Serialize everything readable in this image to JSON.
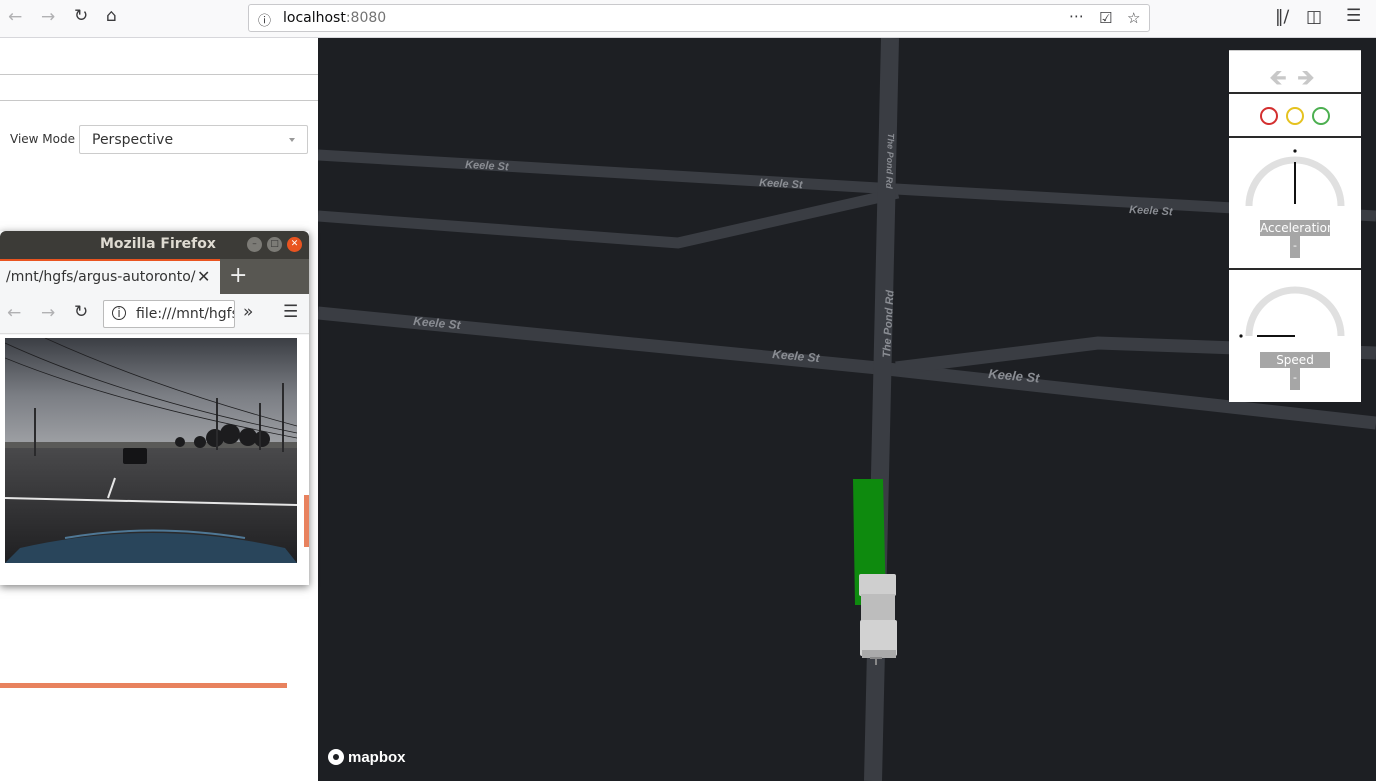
{
  "browser": {
    "url_host": "localhost",
    "url_port": ":8080",
    "icons": [
      "back-icon",
      "forward-icon",
      "reload-icon",
      "home-icon",
      "info-icon",
      "more-icon",
      "pocket-icon",
      "star-icon",
      "library-icon",
      "sidebar-icon",
      "menu-icon"
    ]
  },
  "panel": {
    "view_mode_label": "View Mode",
    "view_mode_value": "Perspective"
  },
  "popup": {
    "title": "Mozilla Firefox",
    "tab_title": "/mnt/hgfs/argus-autoronto/",
    "url": "file:///mnt/hgfs/argus-autoronto/"
  },
  "map": {
    "streets": [
      "Keele St",
      "Keele St",
      "Keele St",
      "Keele St",
      "Keele St",
      "Keele St",
      "The Pond Rd",
      "The Pond Rd"
    ],
    "attribution": "mapbox"
  },
  "widgets": {
    "acceleration_label": "Acceleration",
    "acceleration_value": "-",
    "speed_label": "Speed",
    "speed_value": "-",
    "light_colors": [
      "#d32f2f",
      "#e5c21f",
      "#4caf50"
    ]
  }
}
